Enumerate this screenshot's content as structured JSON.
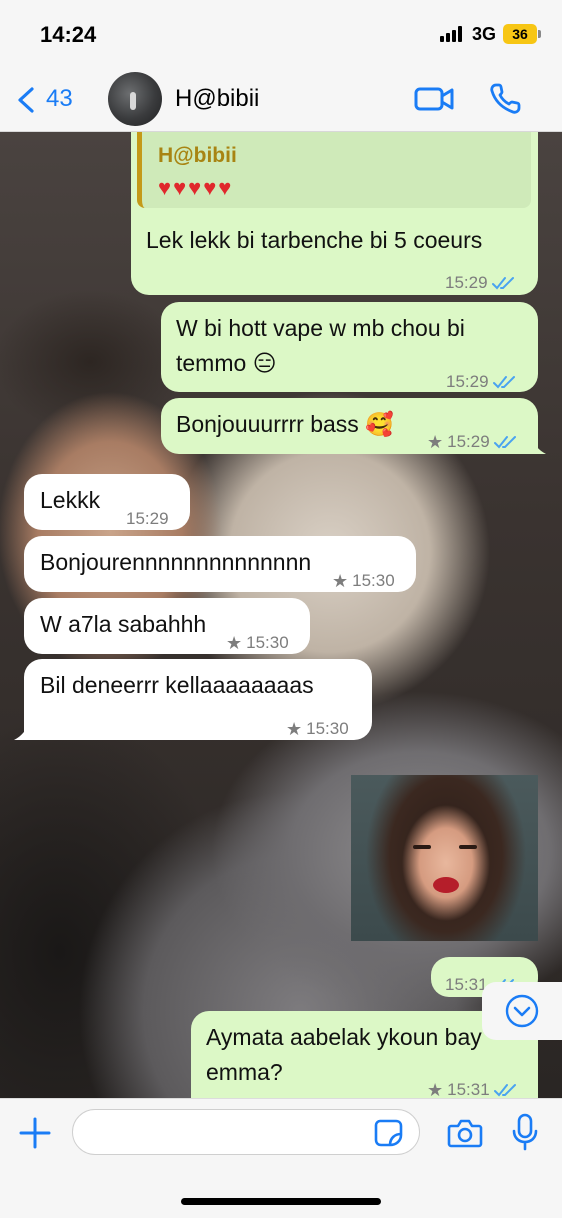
{
  "status_bar": {
    "time": "14:24",
    "network": "3G",
    "battery": "36"
  },
  "header": {
    "back_count": "43",
    "contact_name": "H@bibii"
  },
  "messages": [
    {
      "dir": "out",
      "quote_name": "H@bibii",
      "quote_text": "♥♥♥♥♥",
      "text": "Lek lekk bi tarbenche bi 5 coeurs",
      "time": "15:29"
    },
    {
      "dir": "out",
      "text_line1": "W bi hott vape w mb chou bi",
      "text_line2": "temmo 😑",
      "time": "15:29"
    },
    {
      "dir": "out",
      "text": "Bonjouuurrrr bass 🥰",
      "time": "15:29",
      "starred": true
    },
    {
      "dir": "in",
      "text": "Lekkk",
      "time": "15:29"
    },
    {
      "dir": "in",
      "text": "Bonjourennnnnnnnnnnnnn",
      "time": "15:30",
      "starred": true
    },
    {
      "dir": "in",
      "text": "W a7la sabahhh",
      "time": "15:30",
      "starred": true
    },
    {
      "dir": "in",
      "text": "Bil deneerrr kellaaaaaaaas",
      "time": "15:30",
      "starred": true
    },
    {
      "dir": "out",
      "type": "image",
      "time": "15:31"
    },
    {
      "dir": "out",
      "text_line1": "Aymata aabelak ykoun bay",
      "text_line2": "emma?",
      "time": "15:31",
      "starred": true
    }
  ],
  "composer": {
    "placeholder": ""
  },
  "icons": {
    "back": "chevron-left-icon",
    "video": "video-camera-icon",
    "phone": "phone-icon",
    "plus": "plus-icon",
    "sticker": "sticker-icon",
    "camera": "camera-icon",
    "mic": "microphone-icon",
    "scroll": "chevron-down-circle-icon",
    "star": "star-icon",
    "read": "double-check-icon"
  },
  "colors": {
    "accent": "#1a7cf5",
    "outgoing": "#dcf8c6",
    "incoming": "#ffffff",
    "read_ticks": "#4aa3f0"
  }
}
